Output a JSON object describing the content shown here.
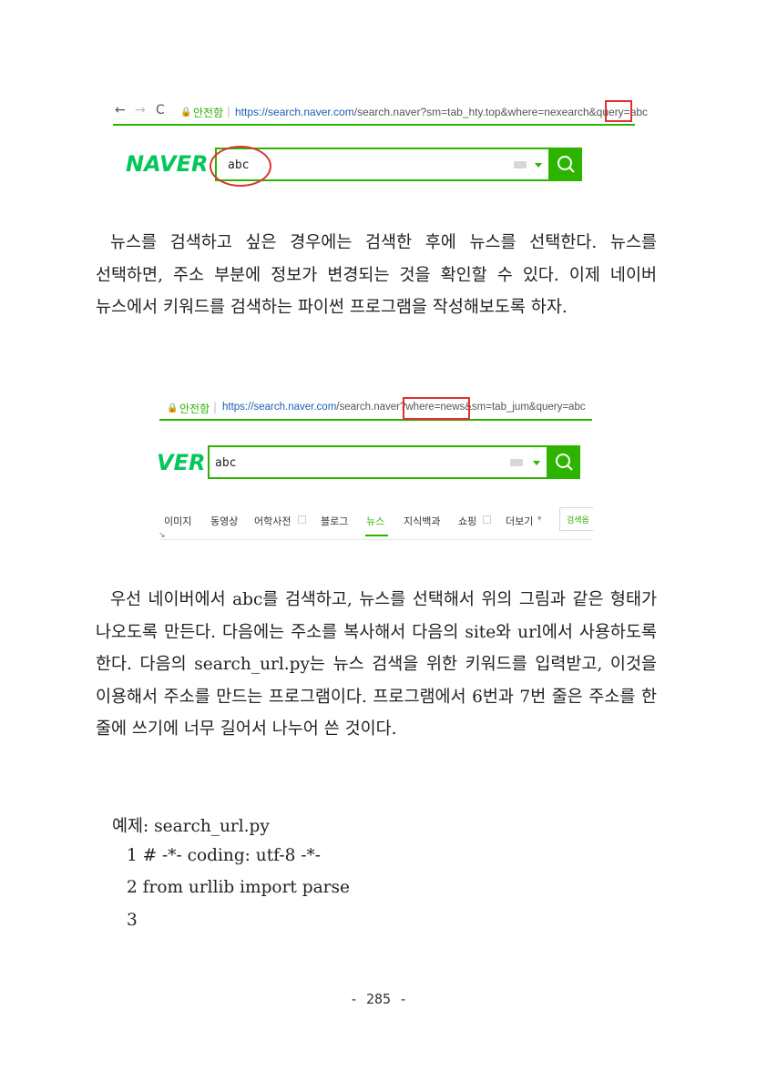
{
  "screenshot1": {
    "nav_back": "←",
    "nav_forward": "→",
    "nav_reload": "C",
    "secure_label": "안전함",
    "separator": "|",
    "url_host": "https://search.naver.com",
    "url_path": "/search.naver?sm=tab_hty.top&where=nexearch&query=",
    "url_query": "abc",
    "logo": "NAVER",
    "search_value": "abc"
  },
  "paragraph1": "뉴스를 검색하고 싶은 경우에는 검색한 후에 뉴스를 선택한다. 뉴스를 선택하면, 주소 부분에 정보가 변경되는 것을 확인할 수 있다. 이제 네이버 뉴스에서 키워드를 검색하는 파이썬 프로그램을 작성해보도록 하자.",
  "screenshot2": {
    "secure_label": "안전함",
    "separator": "|",
    "url_host": "https://search.naver.com",
    "url_path": "/search.naver?",
    "url_highlight": "where=news",
    "url_rest": "&sm=tab_jum&query=abc",
    "logo_partial": "VER",
    "search_value": "abc",
    "tabs": [
      "이미지",
      "동영상",
      "어학사전",
      "블로그",
      "뉴스",
      "지식백과",
      "쇼핑",
      "더보기"
    ],
    "search_options_partial": "검색옵",
    "active_tab": "뉴스"
  },
  "paragraph2": "우선 네이버에서 abc를 검색하고, 뉴스를 선택해서 위의 그림과 같은 형태가 나오도록 만든다. 다음에는 주소를 복사해서 다음의 site와 url에서 사용하도록 한다. 다음의 search_url.py는 뉴스 검색을 위한 키워드를 입력받고, 이것을 이용해서 주소를 만드는 프로그램이다. 프로그램에서 6번과 7번 줄은 주소를 한 줄에 쓰기에 너무 길어서 나누어 쓴 것이다.",
  "example": {
    "title": "예제: search_url.py",
    "lines": [
      "1 # -*- coding: utf-8 -*-",
      "2 from urllib import parse",
      "3"
    ]
  },
  "page_number": "- 285 -",
  "colors": {
    "naver_green": "#2db400",
    "highlight_red": "#e03030"
  }
}
